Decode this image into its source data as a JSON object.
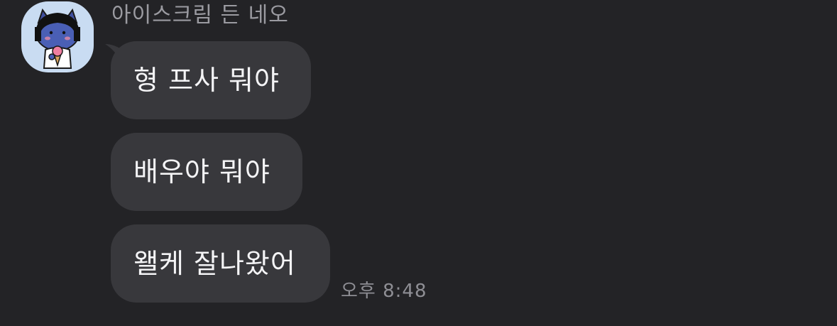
{
  "sender": {
    "name": "아이스크림 든 네오",
    "avatar_icon": "neo-ice-cream-avatar-icon"
  },
  "messages": [
    {
      "text": "형 프사 뭐야"
    },
    {
      "text": "배우야 뭐야"
    },
    {
      "text": "왤케 잘나왔어"
    }
  ],
  "timestamp": "오후 8:48",
  "colors": {
    "background": "#232326",
    "bubble": "#38383c",
    "bubble_text": "#f4f4f6",
    "name_text": "#9b9ba1",
    "time_text": "#8e8e94",
    "avatar_bg": "#c9dcf2"
  }
}
